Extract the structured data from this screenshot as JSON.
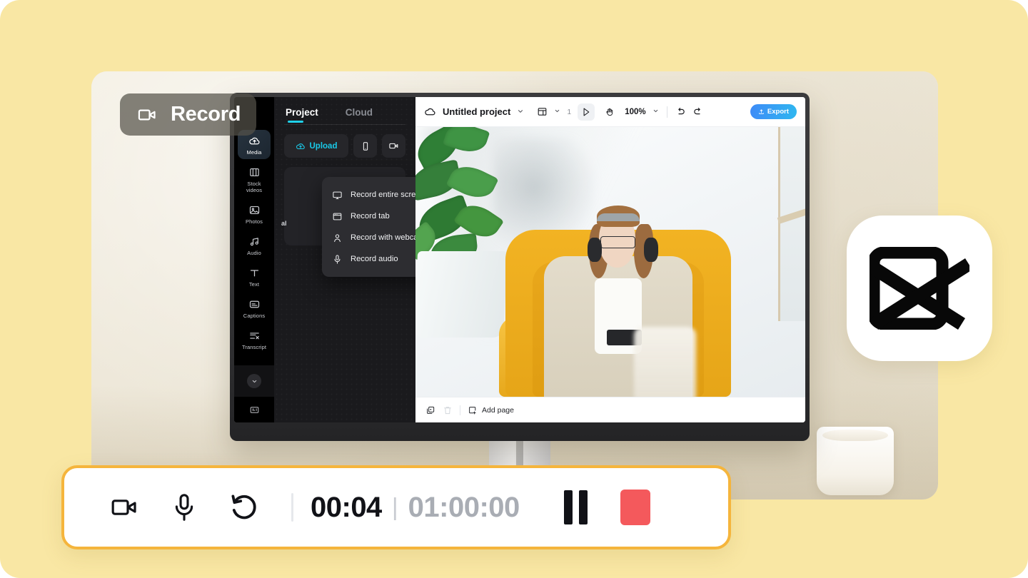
{
  "theme": {
    "page_background": "#F9E7A4",
    "photo_card_background": "#EFE9DB",
    "accent_cyan": "#19C9E8",
    "accent_blue": "#3E8BF7",
    "record_border": "#F5B53C",
    "stop_red": "#F4595C"
  },
  "record_badge": {
    "label": "Record",
    "icon": "video-camera-icon"
  },
  "app": {
    "sidebar": {
      "items": [
        {
          "label": "Media",
          "icon": "cloud-media-icon",
          "active": true
        },
        {
          "label": "Stock videos",
          "icon": "film-strip-icon",
          "active": false
        },
        {
          "label": "Photos",
          "icon": "photo-icon",
          "active": false
        },
        {
          "label": "Audio",
          "icon": "music-note-icon",
          "active": false
        },
        {
          "label": "Text",
          "icon": "text-t-icon",
          "active": false
        },
        {
          "label": "Captions",
          "icon": "captions-icon",
          "active": false
        },
        {
          "label": "Transcript",
          "icon": "transcript-icon",
          "active": false
        }
      ],
      "collapse_icon": "chevron-down-icon",
      "footer_icon": "templates-icon"
    },
    "panel": {
      "tabs": [
        {
          "label": "Project",
          "active": true
        },
        {
          "label": "Cloud",
          "active": false
        }
      ],
      "upload_label": "Upload",
      "upload_icon": "cloud-upload-icon",
      "mobile_upload_icon": "phone-icon",
      "record_icon": "video-camera-icon",
      "partial_text": "al"
    },
    "record_menu": {
      "items": [
        {
          "label": "Record entire screen",
          "icon": "monitor-icon"
        },
        {
          "label": "Record tab",
          "icon": "browser-tab-icon"
        },
        {
          "label": "Record with webcam",
          "icon": "person-icon"
        },
        {
          "label": "Record audio",
          "icon": "microphone-icon"
        }
      ]
    },
    "toolbar": {
      "cloud_icon": "cloud-sync-icon",
      "project_title": "Untitled project",
      "title_chevron": "chevron-down-icon",
      "layout_icon": "layout-icon",
      "layout_chevron": "chevron-down-icon",
      "page_count": "1",
      "cursor_tool_icon": "cursor-arrow-icon",
      "hand_tool_icon": "hand-icon",
      "zoom_level": "100%",
      "zoom_chevron": "chevron-down-icon",
      "undo_icon": "undo-icon",
      "redo_icon": "redo-icon",
      "export_label": "Export",
      "export_icon": "export-icon"
    },
    "pagebar": {
      "duplicate_icon": "duplicate-icon",
      "delete_icon": "trash-icon",
      "add_page_label": "Add page",
      "add_page_icon": "add-page-icon"
    },
    "canvas": {
      "description": "Woman wearing headphones and glasses sitting in a yellow armchair looking at a phone, houseplant at left"
    }
  },
  "control_bar": {
    "camera_icon": "video-camera-icon",
    "mic_icon": "microphone-icon",
    "restart_icon": "restart-arrow-icon",
    "elapsed_time": "00:04",
    "time_separator": "|",
    "total_time": "01:00:00",
    "pause_icon": "pause-icon",
    "stop_icon": "stop-square-icon"
  },
  "capcut_logo": {
    "name": "capcut-logo"
  }
}
